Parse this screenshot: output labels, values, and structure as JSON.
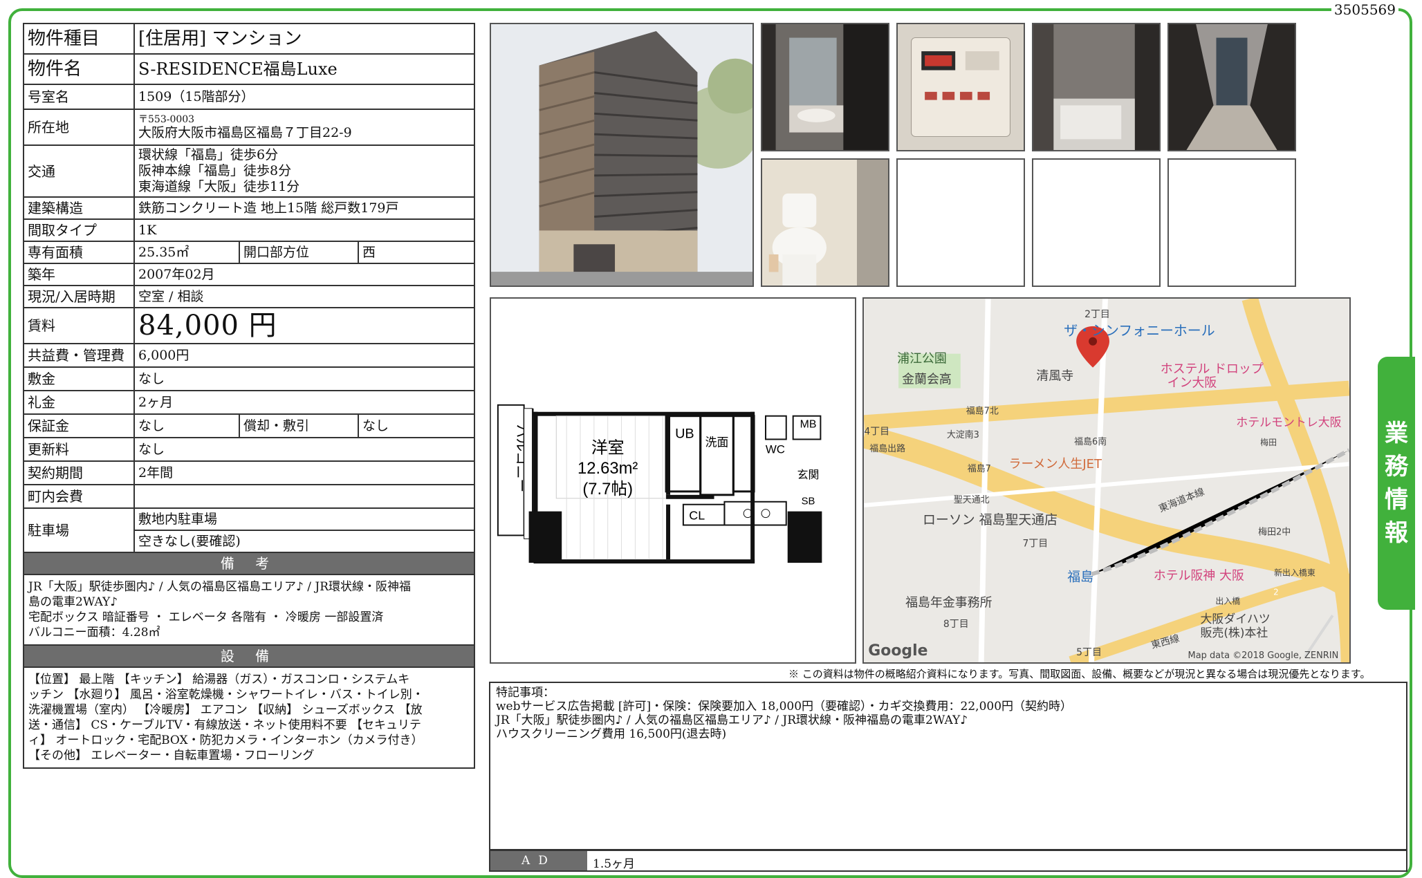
{
  "doc_id": "3505569",
  "badge": [
    "業",
    "務",
    "情",
    "報"
  ],
  "spec": {
    "type": {
      "label": "物件種目",
      "value": "[住居用]  マンション"
    },
    "name": {
      "label": "物件名",
      "value": "S-RESIDENCE福島Luxe"
    },
    "room": {
      "label": "号室名",
      "value": "1509（15階部分）"
    },
    "address": {
      "label": "所在地",
      "zip": "〒553-0003",
      "value": "大阪府大阪市福島区福島７丁目22-9"
    },
    "access": {
      "label": "交通",
      "lines": [
        "環状線「福島」徒歩6分",
        "阪神本線「福島」徒歩8分",
        "東海道線「大阪」徒歩11分"
      ]
    },
    "structure": {
      "label": "建築構造",
      "value": "鉄筋コンクリート造 地上15階 総戸数179戸"
    },
    "layout": {
      "label": "間取タイプ",
      "value": "1K"
    },
    "area": {
      "label": "専有面積",
      "value": "25.35㎡",
      "dir_label": "開口部方位",
      "dir_value": "西"
    },
    "built": {
      "label": "築年",
      "value": "2007年02月"
    },
    "status": {
      "label": "現況/入居時期",
      "value": "空室 /  相談"
    },
    "rent": {
      "label": "賃料",
      "value": "84,000 円"
    },
    "fee": {
      "label": "共益費・管理費",
      "value": "6,000円"
    },
    "deposit": {
      "label": "敷金",
      "value": "なし"
    },
    "key_money": {
      "label": "礼金",
      "value": "2ヶ月"
    },
    "guarantee": {
      "label": "保証金",
      "value": "なし",
      "amort_label": "償却・敷引",
      "amort_value": "なし"
    },
    "renewal": {
      "label": "更新料",
      "value": "なし"
    },
    "contract": {
      "label": "契約期間",
      "value": "2年間"
    },
    "community": {
      "label": "町内会費",
      "value": ""
    },
    "parking": {
      "label": "駐車場",
      "value1": "敷地内駐車場",
      "value2": "空きなし(要確認)"
    },
    "biko_header": "備 考",
    "biko_lines": [
      "JR「大阪」駅徒歩圏内♪ / 人気の福島区福島エリア♪ / JR環状線・阪神福",
      "島の電車2WAY♪",
      "宅配ボックス 暗証番号 ・ エレベータ 各階有 ・ 冷暖房 一部設置済",
      "バルコニー面積：4.28㎡"
    ],
    "setsubi_header": "設 備",
    "setsubi_lines": [
      "【位置】 最上階 【キッチン】 給湯器（ガス）・ガスコンロ・システムキ",
      "ッチン 【水廻り】 風呂・浴室乾燥機・シャワートイレ・バス・トイレ別・",
      "洗濯機置場（室内） 【冷暖房】 エアコン 【収納】 シューズボックス 【放",
      "送・通信】 CS・ケーブルTV・有線放送・ネット使用料不要 【セキュリテ",
      "ィ】 オートロック・宅配BOX・防犯カメラ・インターホン（カメラ付き）",
      "【その他】 エレベーター・自転車置場・フローリング"
    ]
  },
  "floorplan": {
    "balcony": "バルコニー",
    "room_name": "洋室",
    "room_area": "12.63m²",
    "room_tatami": "(7.7帖)",
    "ub": "UB",
    "wash": "洗面",
    "wc": "WC",
    "mb": "MB",
    "entrance": "玄関",
    "sb": "SB",
    "cl": "CL"
  },
  "map": {
    "labels": {
      "chome2": "2丁目",
      "symphony": "ザ・シンフォニーホール",
      "urae": "浦江公園",
      "kinran": "金蘭会高",
      "seifuji": "清風寺",
      "hostel1": "ホステル ドロップ",
      "hostel2": "イン大阪",
      "fuku7n": "福島7北",
      "chome4": "4丁目",
      "oyodo3": "大淀南3",
      "fuku6s": "福島6南",
      "hotelmont": "ホテルモントレ大阪",
      "umeda": "梅田",
      "fukude": "福島出路",
      "fuku7": "福島7",
      "ramen": "ラーメン人生JET",
      "seiten": "聖天通北",
      "tokaido": "東海道本線",
      "lawson": "ローソン 福島聖天通店",
      "chome7": "7丁目",
      "umeda2": "梅田2中",
      "fukushima": "福島",
      "hotelhanshin": "ホテル阪神 大阪",
      "shinde": "新出入橋東",
      "pension": "福島年金事務所",
      "chome8": "8丁目",
      "exit": "出入橋",
      "daihatsu1": "大阪ダイハツ",
      "daihatsu2": "販売(株)本社",
      "tozai": "東西線",
      "chome5": "5丁目",
      "google": "Google",
      "mapdata": "Map data ©2018 Google, ZENRIN",
      "route2": "2"
    }
  },
  "disclaimer": "※ この資料は物件の概略紹介資料になります。写真、間取図面、設備、概要などが現況と異なる場合は現況優先となります。",
  "remarks_lines": [
    "特記事項：",
    "webサービス広告掲載 [許可]・保険：保険要加入 18,000円（要確認）・カギ交換費用：22,000円（契約時）",
    "JR「大阪」駅徒歩圏内♪ / 人気の福島区福島エリア♪ / JR環状線・阪神福島の電車2WAY♪",
    "ハウスクリーニング費用 16,500円(退去時)"
  ],
  "ad": {
    "label": "AD",
    "value": "1.5ヶ月"
  },
  "colors": {
    "brand_green": "#41b13c",
    "header_gray": "#6d6d6d"
  }
}
